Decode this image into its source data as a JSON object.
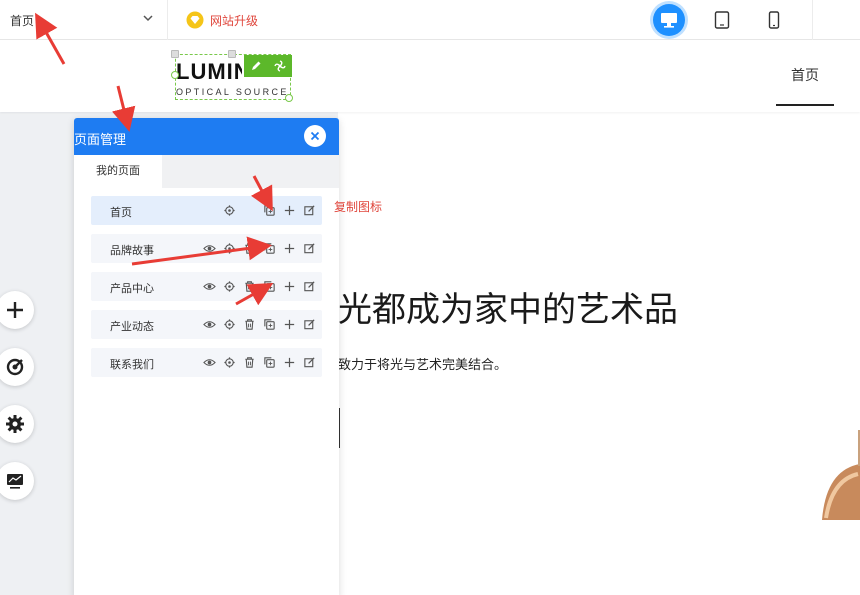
{
  "topbar": {
    "page_select_value": "首页",
    "upgrade_label": "网站升级",
    "devices": [
      "desktop",
      "tablet",
      "mobile"
    ],
    "active_device": "desktop"
  },
  "site": {
    "logo_main": "LUMIN",
    "logo_sub": "OPTICAL SOURCE",
    "nav_home": "首页"
  },
  "hero": {
    "title": "光都成为家中的艺术品",
    "subtitle": "致力于将光与艺术完美结合。"
  },
  "page_manager": {
    "title": "页面管理",
    "tab": "我的页面",
    "pages": [
      {
        "label": "首页",
        "has_visibility": false,
        "has_delete": false
      },
      {
        "label": "品牌故事",
        "has_visibility": true,
        "has_delete": true
      },
      {
        "label": "产品中心",
        "has_visibility": true,
        "has_delete": true
      },
      {
        "label": "产业动态",
        "has_visibility": true,
        "has_delete": true
      },
      {
        "label": "联系我们",
        "has_visibility": true,
        "has_delete": true
      }
    ]
  },
  "annotation": {
    "copy_icon_label": "复制图标"
  },
  "colors": {
    "accent": "#1e7cf2",
    "annotation_red": "#e0463c",
    "logo_tools_green": "#5cb82a"
  }
}
